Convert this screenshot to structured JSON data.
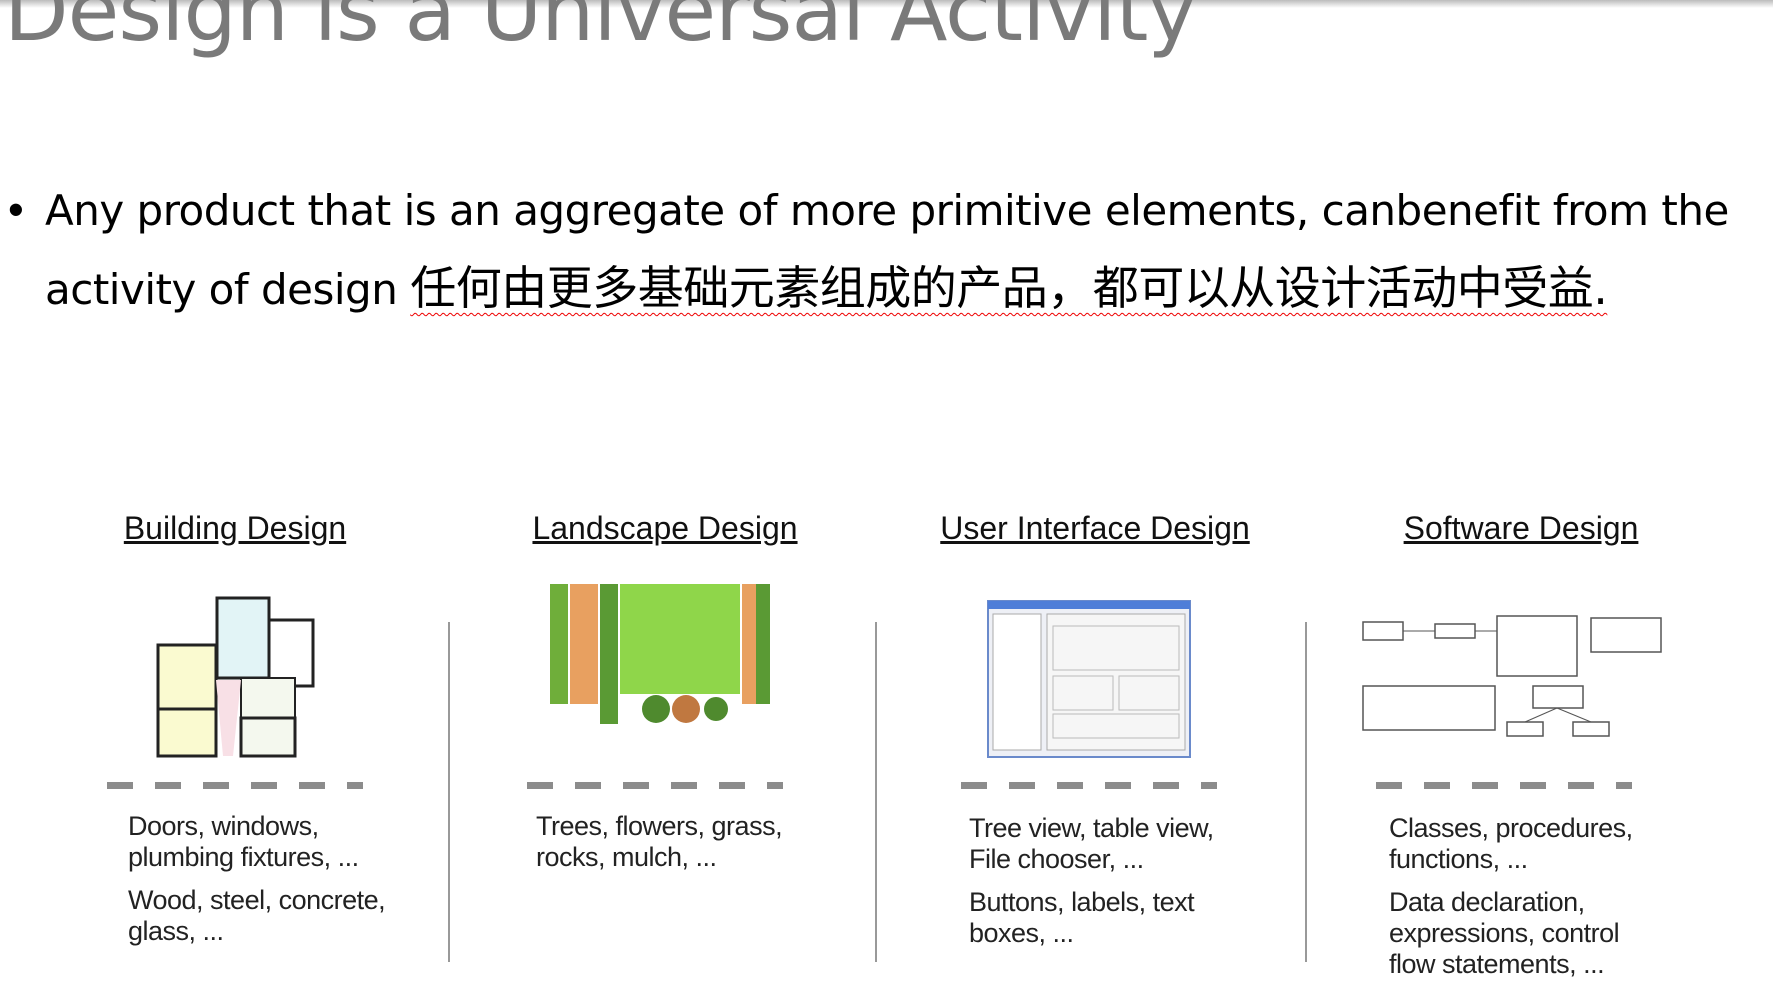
{
  "slide": {
    "title": "Design is a Universal Activity",
    "bullet_line1": "Any product that is an aggregate of more primitive elements, canbenefit from the",
    "bullet_line2_en": "activity of design ",
    "bullet_line2_cn": "任何由更多基础元素组成的产品，都可以从设计活动中受益.",
    "bullet_marker": "•"
  },
  "columns": [
    {
      "heading": "Building Design",
      "image_icon": "floor-plan-image",
      "desc": [
        "Doors, windows, plumbing fixtures, ...",
        "Wood, steel, concrete, glass, ..."
      ]
    },
    {
      "heading": "Landscape Design",
      "image_icon": "landscape-plan-image",
      "desc": [
        "Trees, flowers, grass, rocks, mulch, ..."
      ]
    },
    {
      "heading": "User Interface Design",
      "image_icon": "ui-dialog-image",
      "desc": [
        "Tree view, table view, File chooser, ...",
        "Buttons, labels, text boxes, ..."
      ]
    },
    {
      "heading": "Software Design",
      "image_icon": "uml-diagram-image",
      "desc": [
        "Classes, procedures, functions, ...",
        "Data declaration, expressions, control flow statements, ..."
      ]
    }
  ],
  "colors": {
    "title": "#7a7a7a",
    "spellcheck": "#ee0000",
    "landscape_green": "#8fd64a"
  }
}
